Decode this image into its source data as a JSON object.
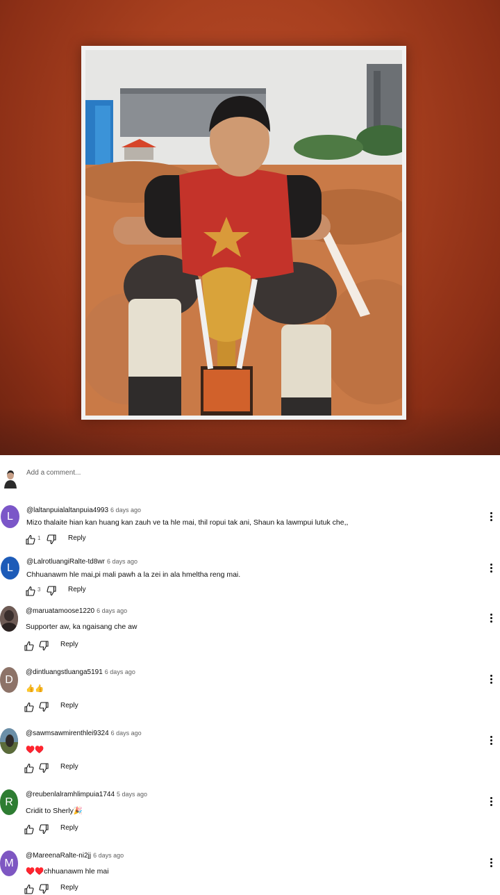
{
  "add_comment": {
    "placeholder": "Add a comment..."
  },
  "comments": [
    {
      "avatar_letter": "L",
      "avatar_color": "#7b56c8",
      "author": "@laltanpuialaltanpuia4993",
      "time": "6 days ago",
      "text": "Mizo thalaite hian kan huang kan zauh ve ta hle mai, thil ropui tak ani, Shaun ka lawmpui lutuk che,,",
      "likes": "1",
      "reply": "Reply"
    },
    {
      "avatar_letter": "L",
      "avatar_color": "#1d5bb8",
      "author": "@LalrotluangiRalte-td8wr",
      "time": "6 days ago",
      "text": "Chhuanawm hle mai,pi mali pawh a la zei in ala hmeltha reng mai.",
      "likes": "3",
      "reply": "Reply"
    },
    {
      "avatar_letter": "",
      "avatar_color": "#5a4a48",
      "author": "@maruatamoose1220",
      "time": "6 days ago",
      "text": "Supporter aw, ka ngaisang che aw",
      "likes": "",
      "reply": "Reply"
    },
    {
      "avatar_letter": "D",
      "avatar_color": "#8d7368",
      "author": "@dintluangstluanga5191",
      "time": "6 days ago",
      "text": "👍👍",
      "likes": "",
      "reply": "Reply"
    },
    {
      "avatar_letter": "",
      "avatar_color": "#4d6a82",
      "author": "@sawmsawmirenthlei9324",
      "time": "6 days ago",
      "text": "♥️♥️",
      "likes": "",
      "reply": "Reply"
    },
    {
      "avatar_letter": "R",
      "avatar_color": "#2e7d32",
      "author": "@reubenlalramhlimpuia1744",
      "time": "5 days ago",
      "text": "Cridit to Sherly🎉",
      "likes": "",
      "reply": "Reply"
    },
    {
      "avatar_letter": "M",
      "avatar_color": "#7e57c2",
      "author": "@MareenaRalte-ni2jj",
      "time": "6 days ago",
      "text": "♥️♥️chhuanawm hle mai",
      "likes": "",
      "reply": "Reply"
    }
  ]
}
